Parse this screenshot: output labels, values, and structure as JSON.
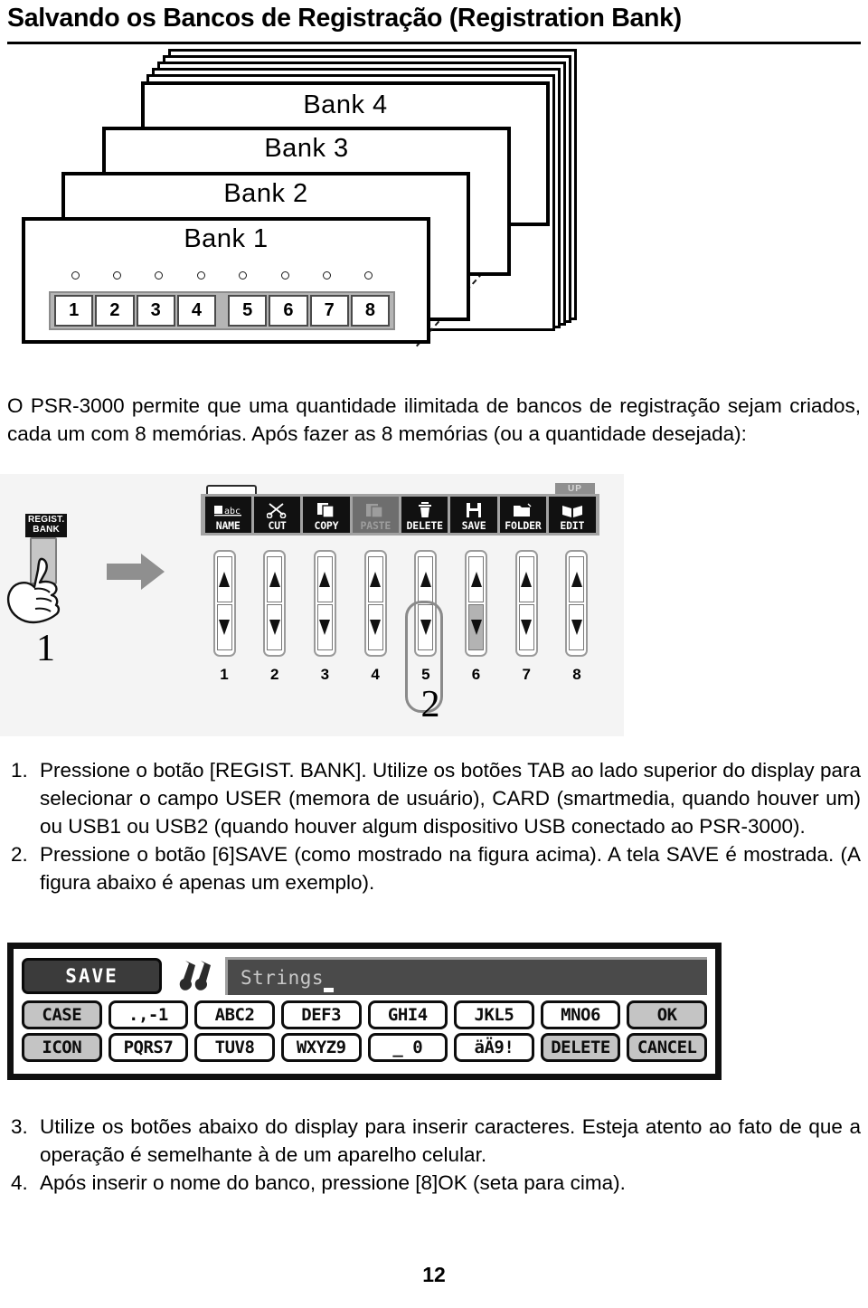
{
  "page": {
    "title": "Salvando os Bancos de Registração (Registration Bank)",
    "number": "12"
  },
  "bank_figure": {
    "cards": [
      {
        "label": "Bank 4"
      },
      {
        "label": "Bank 3"
      },
      {
        "label": "Bank 2"
      },
      {
        "label": "Bank 1"
      }
    ],
    "memory_buttons": [
      "1",
      "2",
      "3",
      "4",
      "5",
      "6",
      "7",
      "8"
    ]
  },
  "intro_paragraph": "O PSR-3000 permite que uma quantidade ilimitada de bancos de registração sejam criados, cada um com 8 memórias. Após fazer as 8 memórias (ou a quantidade desejada):",
  "panel_figure": {
    "regist_button_label_line1": "REGIST.",
    "regist_button_label_line2": "BANK",
    "step1_number": "1",
    "step2_number": "2",
    "up_tab_label": "UP",
    "toolbar_buttons": [
      {
        "label": "NAME",
        "icon": "name-abc-icon",
        "disabled": false
      },
      {
        "label": "CUT",
        "icon": "scissors-icon",
        "disabled": false
      },
      {
        "label": "COPY",
        "icon": "copy-icon",
        "disabled": false
      },
      {
        "label": "PASTE",
        "icon": "paste-icon",
        "disabled": true
      },
      {
        "label": "DELETE",
        "icon": "trash-icon",
        "disabled": false
      },
      {
        "label": "SAVE",
        "icon": "floppy-disk-icon",
        "disabled": false
      },
      {
        "label": "FOLDER",
        "icon": "folder-icon",
        "disabled": false
      },
      {
        "label": "EDIT",
        "icon": "book-edit-icon",
        "disabled": false
      }
    ],
    "slider_numbers": [
      "1",
      "2",
      "3",
      "4",
      "5",
      "6",
      "7",
      "8"
    ],
    "highlighted_slider": "6"
  },
  "instructions_a": [
    {
      "num": "1.",
      "text": "Pressione o botão [REGIST. BANK]. Utilize os botões TAB ao lado superior do display para selecionar o campo USER (memora de usuário), CARD (smartmedia, quando houver um) ou USB1 ou USB2 (quando houver algum dispositivo USB conectado ao PSR-3000)."
    },
    {
      "num": "2.",
      "text": "Pressione o botão [6]SAVE (como mostrado na figura acima). A tela SAVE é mostrada. (A figura abaixo é apenas um exemplo)."
    }
  ],
  "save_dialog": {
    "title": "SAVE",
    "icon_name": "strings-instrument-icon",
    "name_value": "Strings",
    "keys_row1": [
      {
        "label": "CASE",
        "shaded": true
      },
      {
        "label": ".,-1",
        "shaded": false
      },
      {
        "label": "ABC2",
        "shaded": false
      },
      {
        "label": "DEF3",
        "shaded": false
      },
      {
        "label": "GHI4",
        "shaded": false
      },
      {
        "label": "JKL5",
        "shaded": false
      },
      {
        "label": "MNO6",
        "shaded": false
      },
      {
        "label": "OK",
        "shaded": true
      }
    ],
    "keys_row2": [
      {
        "label": "ICON",
        "shaded": true
      },
      {
        "label": "PQRS7",
        "shaded": false
      },
      {
        "label": "TUV8",
        "shaded": false
      },
      {
        "label": "WXYZ9",
        "shaded": false
      },
      {
        "label": "_ 0",
        "shaded": false
      },
      {
        "label": "äÄ9!",
        "shaded": false
      },
      {
        "label": "DELETE",
        "shaded": true
      },
      {
        "label": "CANCEL",
        "shaded": true
      }
    ]
  },
  "instructions_b": [
    {
      "num": "3.",
      "text": "Utilize os botões abaixo do display para inserir caracteres. Esteja atento ao fato de que a operação é semelhante à de um aparelho celular."
    },
    {
      "num": "4.",
      "text": "Após inserir o nome do banco, pressione [8]OK (seta para cima)."
    }
  ]
}
